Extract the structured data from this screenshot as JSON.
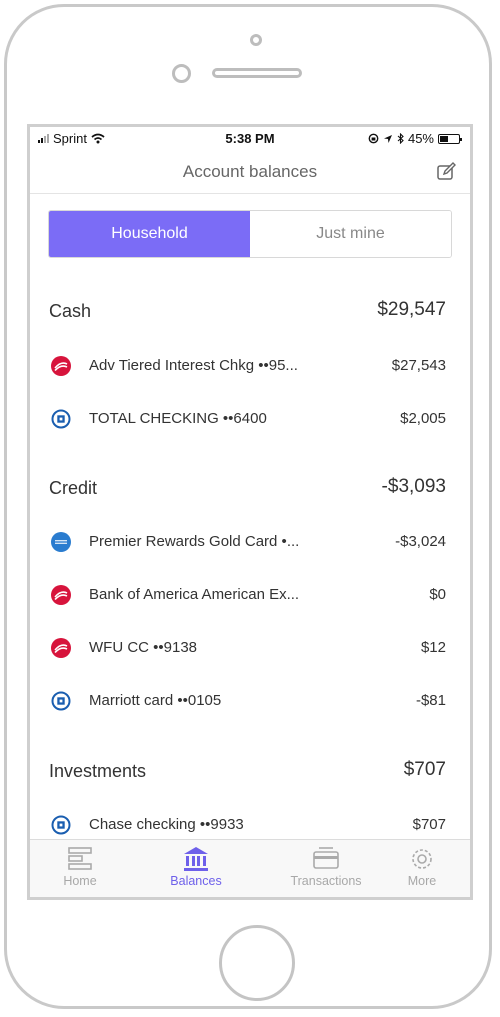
{
  "status": {
    "carrier": "Sprint",
    "time": "5:38 PM",
    "battery": "45%",
    "battery_level": 0.45
  },
  "header": {
    "title": "Account balances"
  },
  "segment": {
    "household": "Household",
    "just_mine": "Just mine",
    "selected": "Household"
  },
  "sections": [
    {
      "title": "Cash",
      "total": "$29,547",
      "rows": [
        {
          "icon": "bank-of-america-icon",
          "name": "Adv Tiered Interest Chkg ••95...",
          "amount": "$27,543"
        },
        {
          "icon": "chase-icon",
          "name": "TOTAL CHECKING ••6400",
          "amount": "$2,005"
        }
      ]
    },
    {
      "title": "Credit",
      "total": "-$3,093",
      "rows": [
        {
          "icon": "amex-icon",
          "name": "Premier Rewards Gold Card •...",
          "amount": "-$3,024"
        },
        {
          "icon": "bank-of-america-icon",
          "name": "Bank of America American Ex...",
          "amount": "$0"
        },
        {
          "icon": "bank-of-america-icon",
          "name": "WFU CC ••9138",
          "amount": "$12"
        },
        {
          "icon": "chase-icon",
          "name": "Marriott card ••0105",
          "amount": "-$81"
        }
      ]
    },
    {
      "title": "Investments",
      "total": "$707",
      "rows": [
        {
          "icon": "chase-icon",
          "name": "Chase checking ••9933",
          "amount": "$707"
        }
      ]
    }
  ],
  "tabs": [
    {
      "label": "Home",
      "icon": "home-icon"
    },
    {
      "label": "Balances",
      "icon": "bank-icon",
      "active": true
    },
    {
      "label": "Transactions",
      "icon": "card-icon"
    },
    {
      "label": "More",
      "icon": "gear-icon"
    }
  ],
  "colors": {
    "accent": "#7b6cf6",
    "boa_red": "#d7143c",
    "chase_blue": "#1a5eb0",
    "amex_blue": "#2a7ccf"
  }
}
